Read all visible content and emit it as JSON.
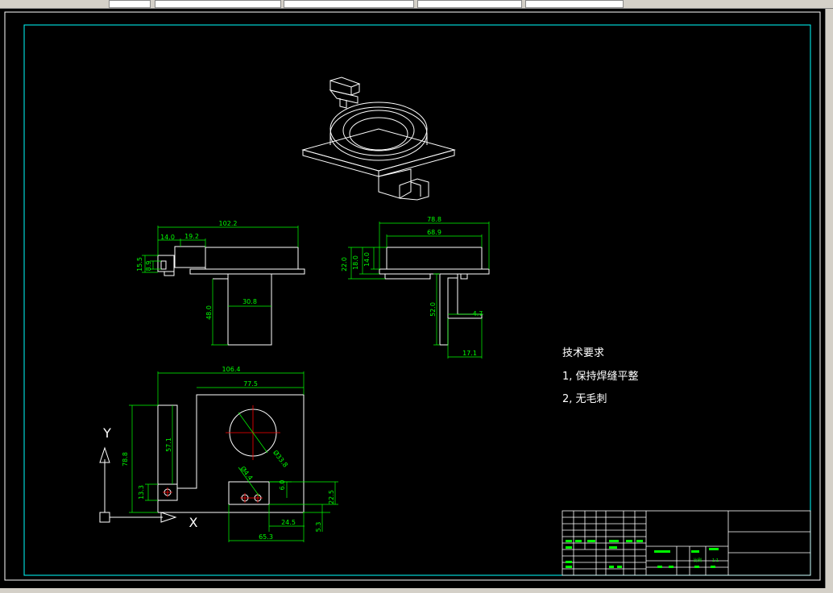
{
  "colors": {
    "background": "#000000",
    "geometry": "#ffffff",
    "dimension": "#00ff00",
    "border": "#00ffff",
    "center": "#ff0000"
  },
  "dims": {
    "front_top_width": "102.2",
    "front_tab_w1": "14.0",
    "front_tab_w2": "19.2",
    "front_h1": "15.5",
    "front_h2": "8.9",
    "front_leg_h": "48.0",
    "front_leg_w": "30.8",
    "side_width": "78.8",
    "side_inner": "68.9",
    "side_h1": "22.0",
    "side_h2": "18.0",
    "side_h3": "14.0",
    "side_leg_h": "52.0",
    "side_thk": "4.7",
    "side_foot": "17.1",
    "top_width": "106.4",
    "top_right": "77.5",
    "top_height": "78.8",
    "top_slot_h": "57.1",
    "top_small_h": "13.3",
    "top_circle": "Ø33.8",
    "top_hole": "Ø4.4",
    "top_v1": "6.0",
    "top_v2": "22.5",
    "top_v3": "5.3",
    "top_h1": "24.5",
    "top_h2": "65.3"
  },
  "ucs": {
    "y": "Y",
    "x": "X"
  },
  "notes": {
    "title": "技术要求",
    "line1": "1, 保持焊缝平整",
    "line2": "2, 无毛刺"
  },
  "title_block": {
    "scale_label": "比例",
    "scale_value": "1:1"
  }
}
